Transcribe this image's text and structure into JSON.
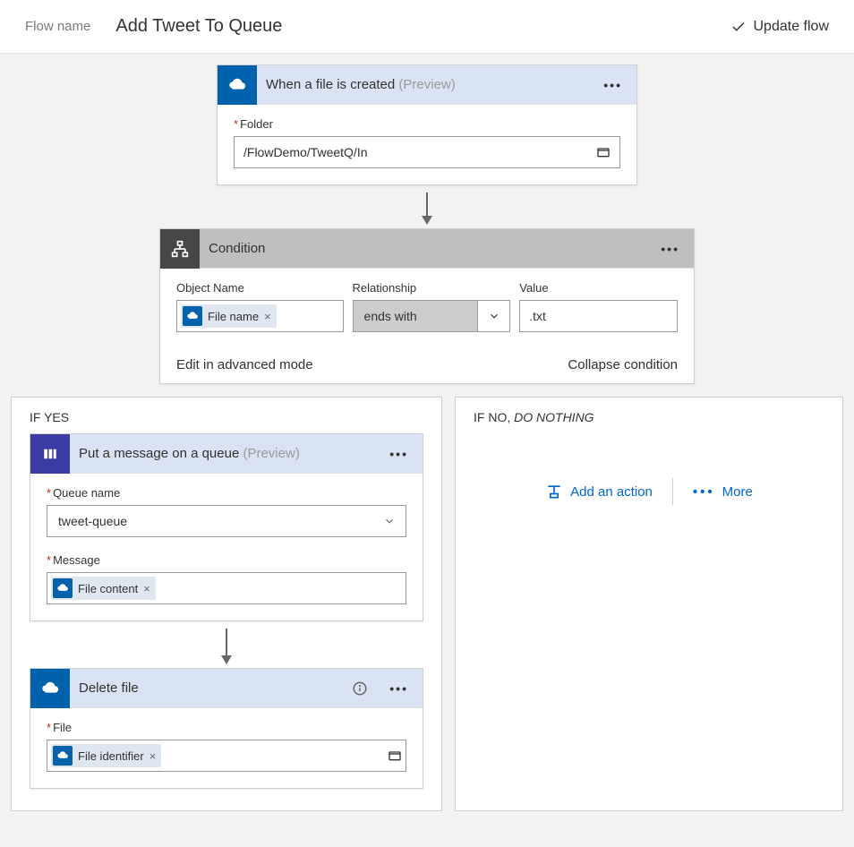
{
  "header": {
    "flow_name_label": "Flow name",
    "title": "Add Tweet To Queue",
    "update_label": "Update flow"
  },
  "trigger": {
    "title": "When a file is created",
    "preview": "(Preview)",
    "folder_label": "Folder",
    "folder_value": "/FlowDemo/TweetQ/In"
  },
  "condition": {
    "title": "Condition",
    "object_label": "Object Name",
    "rel_label": "Relationship",
    "value_label": "Value",
    "chip_label": "File name",
    "rel_value": "ends with",
    "value_value": ".txt",
    "edit_advanced": "Edit in advanced mode",
    "collapse": "Collapse condition"
  },
  "branches": {
    "yes_label": "IF YES",
    "no_label_prefix": "IF NO,",
    "no_label_suffix": "DO NOTHING",
    "add_action": "Add an action",
    "more": "More"
  },
  "queue_action": {
    "title": "Put a message on a queue",
    "preview": "(Preview)",
    "queue_label": "Queue name",
    "queue_value": "tweet-queue",
    "message_label": "Message",
    "message_chip": "File content"
  },
  "delete_action": {
    "title": "Delete file",
    "file_label": "File",
    "file_chip": "File identifier"
  }
}
